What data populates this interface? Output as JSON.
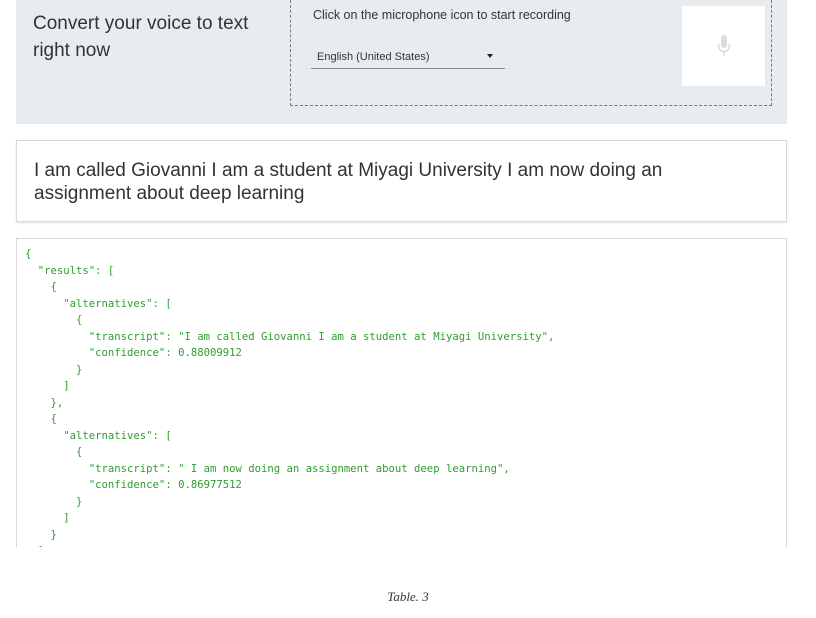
{
  "hero": {
    "title": "Convert your voice to text right now",
    "instructions": "Click on the microphone icon to start recording",
    "language_select": {
      "selected": "English (United States)"
    },
    "mic_icon": "microphone-icon"
  },
  "transcript": {
    "text": "I am called Giovanni I am a student at Miyagi University I am now doing an assignment about deep learning"
  },
  "json_output": {
    "text": "{\n  \"results\": [\n    {\n      \"alternatives\": [\n        {\n          \"transcript\": \"I am called Giovanni I am a student at Miyagi University\",\n          \"confidence\": 0.88009912\n        }\n      ]\n    },\n    {\n      \"alternatives\": [\n        {\n          \"transcript\": \" I am now doing an assignment about deep learning\",\n          \"confidence\": 0.86977512\n        }\n      ]\n    }\n  ]"
  },
  "caption": "Table. 3",
  "colors": {
    "panel_bg": "#e9ecef",
    "json_text": "#2e9e2e",
    "body_text": "#333333"
  }
}
